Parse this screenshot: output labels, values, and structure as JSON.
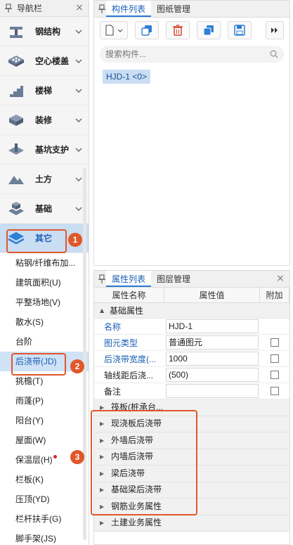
{
  "nav": {
    "title": "导航栏",
    "categories": [
      {
        "label": "钢结构",
        "icon": "steel-structure-icon"
      },
      {
        "label": "空心楼盖",
        "icon": "hollow-floor-icon"
      },
      {
        "label": "楼梯",
        "icon": "stairs-icon"
      },
      {
        "label": "装修",
        "icon": "decoration-icon"
      },
      {
        "label": "基坑支护",
        "icon": "pit-support-icon"
      },
      {
        "label": "土方",
        "icon": "earthwork-icon"
      },
      {
        "label": "基础",
        "icon": "foundation-icon"
      },
      {
        "label": "其它",
        "icon": "other-layers-icon"
      }
    ],
    "sub_items": [
      "粘钢/纤维布加...",
      "建筑面积(U)",
      "平整场地(V)",
      "散水(S)",
      "台阶",
      "后浇带(JD)",
      "挑檐(T)",
      "雨蓬(P)",
      "阳台(Y)",
      "屋面(W)",
      "保温层(H)",
      "栏板(K)",
      "压顶(YD)",
      "栏杆扶手(G)",
      "脚手架(JS)"
    ]
  },
  "component_panel": {
    "tabs": [
      "构件列表",
      "图纸管理"
    ],
    "search_placeholder": "搜索构件...",
    "items": [
      "HJD-1 <0>"
    ]
  },
  "props_panel": {
    "tabs": [
      "属性列表",
      "图层管理"
    ],
    "columns": [
      "属性名称",
      "属性值",
      "附加"
    ],
    "group_basic": "基础属性",
    "rows": [
      {
        "name": "名称",
        "value": "HJD-1"
      },
      {
        "name": "图元类型",
        "value": "普通图元"
      },
      {
        "name": "后浇带宽度(...",
        "value": "1000"
      },
      {
        "name": "轴线距后浇...",
        "value": "(500)"
      },
      {
        "name": "备注",
        "value": ""
      }
    ],
    "sub_groups": [
      "筏板(桩承台...",
      "现浇板后浇带",
      "外墙后浇带",
      "内墙后浇带",
      "梁后浇带",
      "基础梁后浇带"
    ],
    "tail_groups": [
      "钢筋业务属性",
      "土建业务属性"
    ]
  },
  "annotations": [
    "1",
    "2",
    "3"
  ],
  "colors": {
    "accent": "#2a7ad5",
    "highlight": "#e0572a",
    "selected_bg": "#c9ddf3"
  }
}
